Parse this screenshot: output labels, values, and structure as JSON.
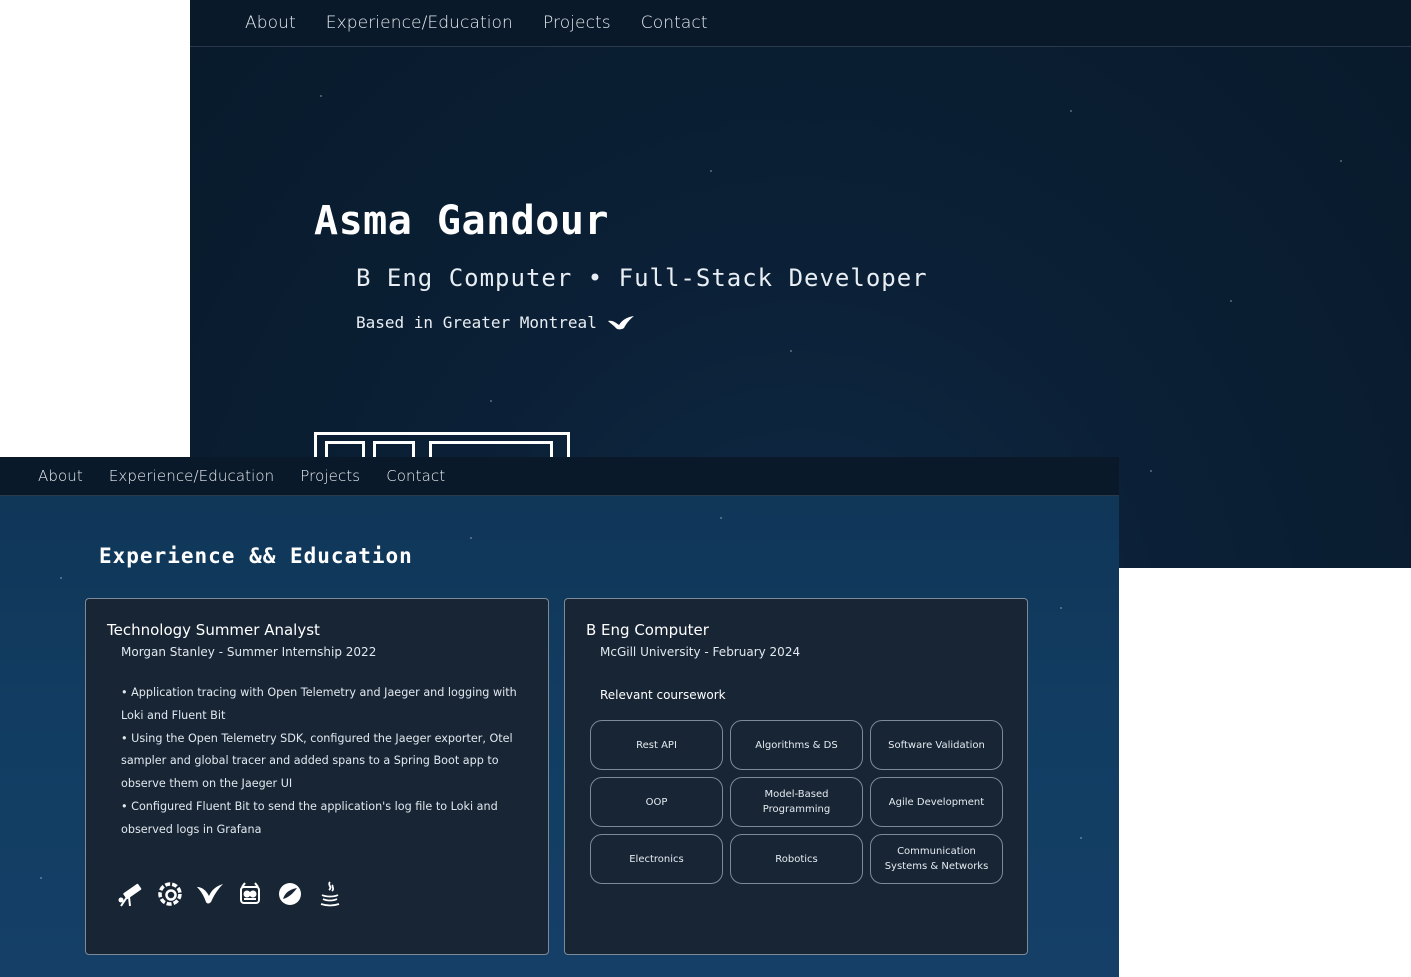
{
  "hero_window": {
    "nav": [
      "About",
      "Experience/Education",
      "Projects",
      "Contact"
    ],
    "name": "Asma Gandour",
    "subtitle": "B Eng Computer • Full-Stack Developer",
    "location": "Based in Greater Montreal",
    "location_icon": "bird-icon"
  },
  "experience_window": {
    "nav": [
      "About",
      "Experience/Education",
      "Projects",
      "Contact"
    ],
    "section_title": "Experience && Education",
    "job": {
      "title": "Technology Summer Analyst",
      "org": "Morgan Stanley - Summer Internship 2022",
      "bullets": [
        "• Application tracing with Open Telemetry and Jaeger and logging with Loki and Fluent Bit",
        "• Using the Open Telemetry SDK, configured the Jaeger exporter, Otel sampler and global tracer and added spans to a Spring Boot app to observe them on the Jaeger UI",
        "• Configured Fluent Bit to send the application's log file to Loki and observed logs in Grafana"
      ],
      "tech_icons": [
        "telescope-icon",
        "grafana-icon",
        "fluent-bit-icon",
        "jaeger-icon",
        "spring-icon",
        "java-icon"
      ]
    },
    "education": {
      "title": "B Eng Computer",
      "org": "McGill University - February 2024",
      "coursework_heading": "Relevant coursework",
      "courses": [
        "Rest API",
        "Algorithms & DS",
        "Software Validation",
        "OOP",
        "Model-Based Programming",
        "Agile Development",
        "Electronics",
        "Robotics",
        "Communication Systems & Networks"
      ]
    }
  },
  "colors": {
    "nav_bg": "#0a1929",
    "hero_bg": "#081a2b",
    "section_bg": "#123d63",
    "card_bg": "#172535",
    "card_border": "#7d8a98",
    "text": "#ffffff"
  }
}
